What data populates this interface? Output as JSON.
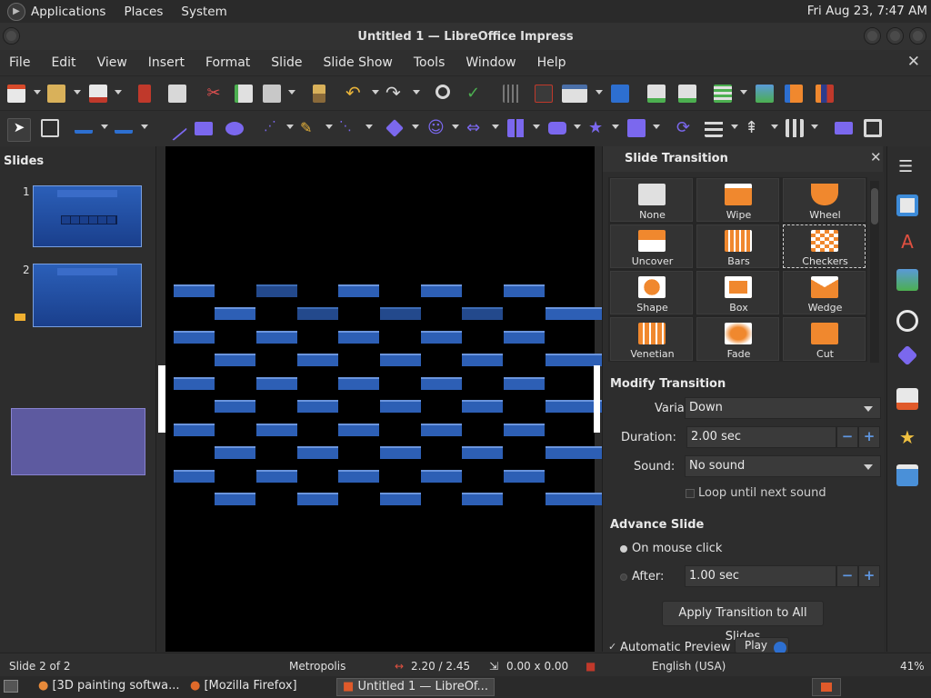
{
  "topbar": {
    "menus": [
      "Applications",
      "Places",
      "System"
    ],
    "clock": "Fri Aug 23,  7:47 AM"
  },
  "window": {
    "title": "Untitled 1 — LibreOffice Impress"
  },
  "menubar": {
    "items": [
      "File",
      "Edit",
      "View",
      "Insert",
      "Format",
      "Slide",
      "Slide Show",
      "Tools",
      "Window",
      "Help"
    ]
  },
  "slides_pane": {
    "title": "Slides",
    "slides": [
      {
        "number": "1"
      },
      {
        "number": "2"
      }
    ]
  },
  "sidebar": {
    "title": "Slide Transition",
    "transitions": [
      "None",
      "Wipe",
      "Wheel",
      "Uncover",
      "Bars",
      "Checkers",
      "Shape",
      "Box",
      "Wedge",
      "Venetian",
      "Fade",
      "Cut"
    ],
    "selected": "Checkers",
    "modify": {
      "title": "Modify Transition",
      "variant_label": "Variant:",
      "variant_value": "Down",
      "duration_label": "Duration:",
      "duration_value": "2.00 sec",
      "sound_label": "Sound:",
      "sound_value": "No sound",
      "loop_label": "Loop until next sound"
    },
    "advance": {
      "title": "Advance Slide",
      "on_click_label": "On mouse click",
      "after_label": "After:",
      "after_value": "1.00 sec"
    },
    "apply_all_label": "Apply Transition to All Slides",
    "auto_preview_label": "Automatic Preview",
    "play_label": "Play"
  },
  "statusbar": {
    "slide_info": "Slide 2 of 2",
    "master": "Metropolis",
    "position": "2.20 / 2.45",
    "size": "0.00 x 0.00",
    "language": "English (USA)",
    "zoom": "41%"
  },
  "taskbar": {
    "tasks": [
      "[3D painting softwa...",
      "[Mozilla Firefox]",
      "Untitled 1 — LibreOf..."
    ]
  },
  "colors": {
    "accent": "#f0882e",
    "brand_blue": "#2d5fb5",
    "selection": "#5d5aa0"
  }
}
